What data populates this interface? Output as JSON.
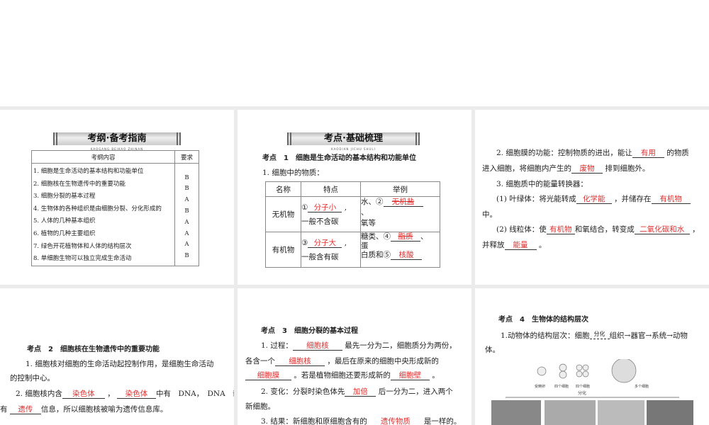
{
  "p1": {
    "banner": "考纲·备考指南",
    "banner_sub": "KAOGANG   BEIKAO ZHINAN",
    "col_content": "考纲内容",
    "col_req": "要求",
    "rows": [
      {
        "t": "1. 细胞是生命活动的基本结构和功能单位",
        "r": "B"
      },
      {
        "t": "2. 细胞核在生物遗传中的重要功能",
        "r": "B"
      },
      {
        "t": "3. 细胞分裂的基本过程",
        "r": "A"
      },
      {
        "t": "4. 生物体的各种组织是由细胞分裂、分化形成的",
        "r": "B"
      },
      {
        "t": "5. 人体的几种基本组织",
        "r": "A"
      },
      {
        "t": "6. 植物的几种主要组织",
        "r": "A"
      },
      {
        "t": "7. 绿色开花植物体和人体的结构层次",
        "r": "A"
      },
      {
        "t": "8. 单细胞生物可以独立完成生命活动",
        "r": "B"
      }
    ]
  },
  "p2": {
    "banner": "考点·基础梳理",
    "banner_sub": "KAODIAN   JICHU SHULI",
    "heading": "考点　1　细胞是生命活动的基本结构和功能单位",
    "sub": "1. 细胞中的物质：",
    "th": [
      "名称",
      "特点",
      "举例"
    ],
    "r1": {
      "name": "无机物",
      "f1": "①",
      "a1": "分子小",
      "f2": "一般不含碳",
      "e1": "水、②",
      "a2": "无机盐",
      "e2": "、",
      "e3": "氧等"
    },
    "r2": {
      "name": "有机物",
      "f1": "③",
      "a1": "分子大",
      "f2": "一般含有碳",
      "e1": "糖类、④",
      "a2": "脂质",
      "e2": "、",
      "e3": "蛋",
      "e4": "白质和⑤",
      "a3": "核酸"
    }
  },
  "p3": {
    "l1a": "2. 细胞膜的功能：控制物质的进出，能让",
    "a1": "有用",
    "l1b": "的物质",
    "l2a": "进入细胞，将细胞内产生的",
    "a2": "废物",
    "l2b": "排到细胞外。",
    "l3": "3. 细胞质中的能量转换器：",
    "l4a": "(1) 叶绿体：将光能转成",
    "a3": "化学能",
    "l4b": "，并储存在",
    "a4": "有机物",
    "l5": "中。",
    "l6a": "(2) 线粒体：使",
    "a5": "有机物",
    "l6b": "和氧结合，转变成",
    "a6": "二氧化碳和水",
    "l6c": "，",
    "l7a": "并释放",
    "a7": "能量",
    "l7b": "。"
  },
  "p4": {
    "heading": "考点　2　细胞核在生物遗传中的重要功能",
    "l1": "1. 细胞核对细胞的生命活动起控制作用，是细胞生命活动",
    "l2": "的控制中心。",
    "l3a": "2. 细胞核内含",
    "a1": "染色体",
    "l3b": "，",
    "a2": "染色体",
    "l3c": "中有　DNA，　DNA　载",
    "l4a": "有",
    "a3": "遗传",
    "l4b": "信息，所以细胞核被喻为遗传信息库。"
  },
  "p5": {
    "heading": "考点　3　细胞分裂的基本过程",
    "l1a": "1. 过程：",
    "a1": "细胞核",
    "l1b": "最先一分为二，细胞质分为两份，",
    "l2a": "各含一个",
    "a2": "细胞核",
    "l2b": "，最后在原来的细胞中央形成新的",
    "a3": "细胞膜",
    "l3b": "。若是植物细胞还要形成新的",
    "a4": "细胞壁",
    "l3c": "。",
    "l4a": "2. 变化：分裂时染色体先",
    "a5": "加倍",
    "l4b": "后一分为二，进入两个",
    "l5": "新细胞。",
    "l6a": "3. 结果：新细胞和原细胞含有的",
    "a6": "遗传物质",
    "l6b": "是一样的。"
  },
  "p6": {
    "heading": "考点　4　生物体的结构层次",
    "l1a": "1.动物体的结构层次：细胞",
    "arrow": "分化",
    "l1b": "组织→器官→系统→动物",
    "l2": "体。",
    "fig": {
      "c1": "受精卵",
      "c2": "四个细胞",
      "c3": "四个细胞",
      "c4": "多个细胞",
      "diff": "分化"
    }
  }
}
